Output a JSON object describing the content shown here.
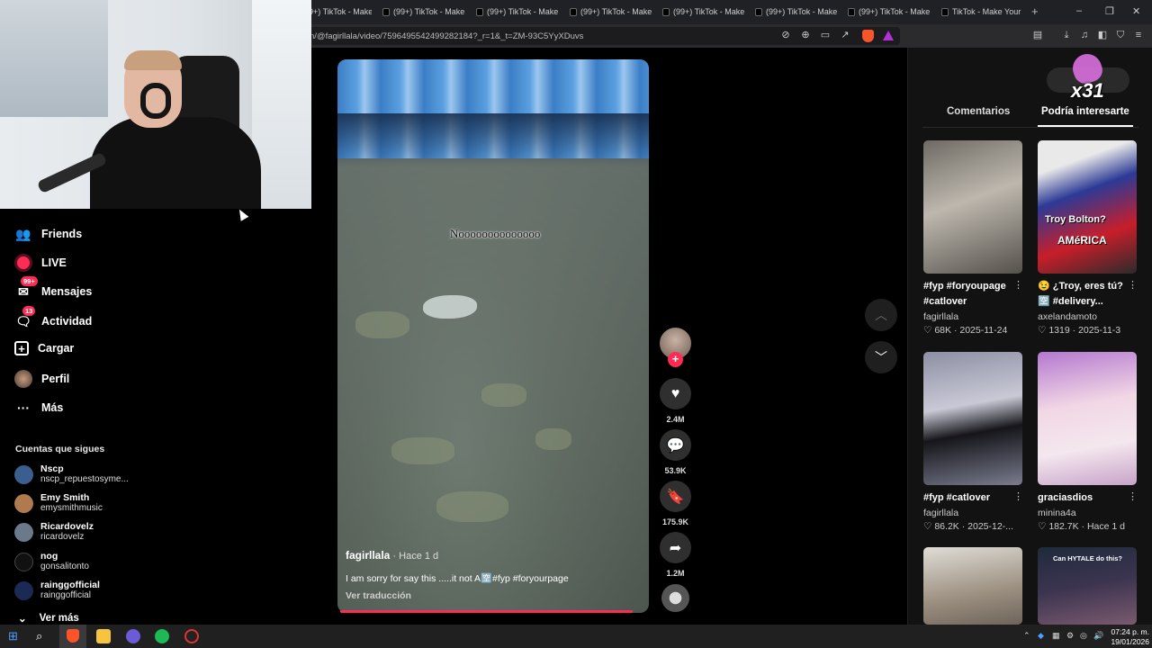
{
  "browser": {
    "tabs": [
      {
        "label": "(99+) TikTok - Make"
      },
      {
        "label": "(99+) TikTok - Make"
      },
      {
        "label": "(99+) TikTok - Make"
      },
      {
        "label": "(99+) TikTok - Make"
      },
      {
        "label": "(99+) TikTok - Make"
      },
      {
        "label": "(99+) TikTok - Make"
      },
      {
        "label": "(99+) TikTok - Make"
      },
      {
        "label": "TikTok - Make Your"
      }
    ],
    "first_tab_partial": "9+) TikTok - Make",
    "url": "n/@fagirllala/video/7596495542499282184?_r=1&_t=ZM-93C5YyXDuvs",
    "new_tab": "+",
    "win_min": "–",
    "win_max": "❐",
    "win_close": "✕",
    "brand_colors": {
      "accent": "#fe2c55",
      "brave": "#fb542b"
    }
  },
  "sidebar": {
    "items": [
      {
        "label": "Friends",
        "icon": "friends-icon"
      },
      {
        "label": "LIVE",
        "icon": "live-icon"
      },
      {
        "label": "Mensajes",
        "icon": "messages-icon",
        "badge": "99+"
      },
      {
        "label": "Actividad",
        "icon": "activity-icon",
        "badge": "13"
      },
      {
        "label": "Cargar",
        "icon": "upload-icon"
      },
      {
        "label": "Perfil",
        "icon": "profile-icon"
      },
      {
        "label": "Más",
        "icon": "more-icon"
      }
    ],
    "following_title": "Cuentas que sigues",
    "following": [
      {
        "name": "Nscp",
        "handle": "nscp_repuestosyme..."
      },
      {
        "name": "Emy Smith",
        "handle": "emysmithmusic"
      },
      {
        "name": "Ricardovelz",
        "handle": "ricardovelz"
      },
      {
        "name": "nog",
        "handle": "gonsalitonto"
      },
      {
        "name": "rainggofficial",
        "handle": "rainggofficial"
      }
    ],
    "see_more": "Ver más"
  },
  "video": {
    "overlay_text": "Noooooooooooooo",
    "author": "fagirllala",
    "time": " · Hace 1 d",
    "description": "I am sorry for say this .....it not A🈳#fyp #foryourpage",
    "translate": "Ver traducción",
    "progress": 0.94
  },
  "actions": {
    "likes": "2.4M",
    "comments": "53.9K",
    "saves": "175.9K",
    "shares": "1.2M"
  },
  "right_panel": {
    "tab_comments": "Comentarios",
    "tab_interest": "Podría interesarte",
    "gift_count": "x31",
    "cards": [
      {
        "title": "#fyp #foryoupage #catlover",
        "author": "fagirllala",
        "likes": "68K",
        "date": "2025-11-24",
        "colors": [
          "#5c5852",
          "#bcb6ae"
        ]
      },
      {
        "title": "😉 ¿Troy, eres tú?🈳 #delivery...",
        "author": "axelandamoto",
        "likes": "1319",
        "date": "2025-11-3",
        "colors": [
          "#2f3b9a",
          "#f1c40f"
        ],
        "thumb_text_1": "Troy Bolton?",
        "thumb_text_2": "AMéRICA"
      },
      {
        "title": "#fyp #catlover",
        "author": "fagirllala",
        "likes": "86.2K",
        "date": "2025-12-...",
        "colors": [
          "#6b6f86",
          "#c9c9d6"
        ]
      },
      {
        "title": "graciasdios",
        "author": "minina4a",
        "likes": "182.7K",
        "date": "Hace 1 d",
        "colors": [
          "#c8a0d6",
          "#f3d2e6"
        ]
      },
      {
        "title": "",
        "author": "",
        "likes": "",
        "date": "",
        "colors": [
          "#d6d6d0",
          "#8a7f70"
        ]
      },
      {
        "title": "",
        "author": "",
        "likes": "",
        "date": "",
        "colors": [
          "#1d2a3a",
          "#6b4e63"
        ],
        "thumb_text_1": "Can HYTALE do this?"
      }
    ]
  },
  "taskbar": {
    "time": "07:24 p. m.",
    "date": "19/01/2026"
  }
}
